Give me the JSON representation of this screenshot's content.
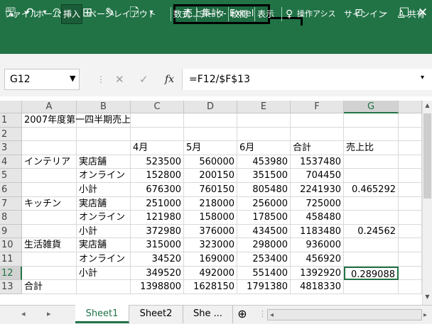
{
  "titlebar": {
    "save_icon": "save-icon",
    "undo_icon": "undo-icon",
    "redo_icon": "redo-icon",
    "title": "売上集計 - Excel",
    "icons": [
      "🖫",
      "↶",
      "↷",
      "⊞",
      "✎",
      "🗋"
    ],
    "window_controls": [
      "ribbon-display-icon",
      "minimize-icon",
      "maximize-icon",
      "close-icon"
    ]
  },
  "ribbon": {
    "tabs": [
      "ファイル",
      "ホーム",
      "挿入",
      "ページレイアウト",
      "数式",
      "データ",
      "校閲",
      "表示"
    ],
    "active_tab": "挿入",
    "tellme": "操作アシス",
    "signin": "サインイン",
    "share": "共有"
  },
  "formula_bar": {
    "name_box": "G12",
    "fx": "fx",
    "formula": "=F12/$F$13"
  },
  "columns": [
    "A",
    "B",
    "C",
    "D",
    "E",
    "F",
    "G"
  ],
  "rows": [
    {
      "n": "1",
      "cells": [
        "2007年度第一四半期売上",
        "",
        "",
        "",
        "",
        "",
        ""
      ]
    },
    {
      "n": "2",
      "cells": [
        "",
        "",
        "",
        "",
        "",
        "",
        ""
      ]
    },
    {
      "n": "3",
      "cells": [
        "",
        "",
        "4月",
        "5月",
        "6月",
        "合計",
        "売上比"
      ]
    },
    {
      "n": "4",
      "cells": [
        "インテリア",
        "実店舗",
        "523500",
        "560000",
        "453980",
        "1537480",
        ""
      ]
    },
    {
      "n": "5",
      "cells": [
        "",
        "オンライン",
        "152800",
        "200150",
        "351500",
        "704450",
        ""
      ]
    },
    {
      "n": "6",
      "cells": [
        "",
        "小計",
        "676300",
        "760150",
        "805480",
        "2241930",
        "0.465292"
      ]
    },
    {
      "n": "7",
      "cells": [
        "キッチン",
        "実店舗",
        "251000",
        "218000",
        "256000",
        "725000",
        ""
      ]
    },
    {
      "n": "8",
      "cells": [
        "",
        "オンライン",
        "121980",
        "158000",
        "178500",
        "458480",
        ""
      ]
    },
    {
      "n": "9",
      "cells": [
        "",
        "小計",
        "372980",
        "376000",
        "434500",
        "1183480",
        "0.24562"
      ]
    },
    {
      "n": "10",
      "cells": [
        "生活雑貨",
        "実店舗",
        "315000",
        "323000",
        "298000",
        "936000",
        ""
      ]
    },
    {
      "n": "11",
      "cells": [
        "",
        "オンライン",
        "34520",
        "169000",
        "253400",
        "456920",
        ""
      ]
    },
    {
      "n": "12",
      "cells": [
        "",
        "小計",
        "349520",
        "492000",
        "551400",
        "1392920",
        "0.289088"
      ]
    },
    {
      "n": "13",
      "cells": [
        "合計",
        "",
        "1398800",
        "1628150",
        "1791380",
        "4818330",
        ""
      ]
    }
  ],
  "selected_cell": "G12",
  "sheets": [
    "Sheet1",
    "Sheet2",
    "She ..."
  ],
  "active_sheet": "Sheet1",
  "colors": {
    "excel_green": "#217346",
    "highlight": "#000000"
  }
}
